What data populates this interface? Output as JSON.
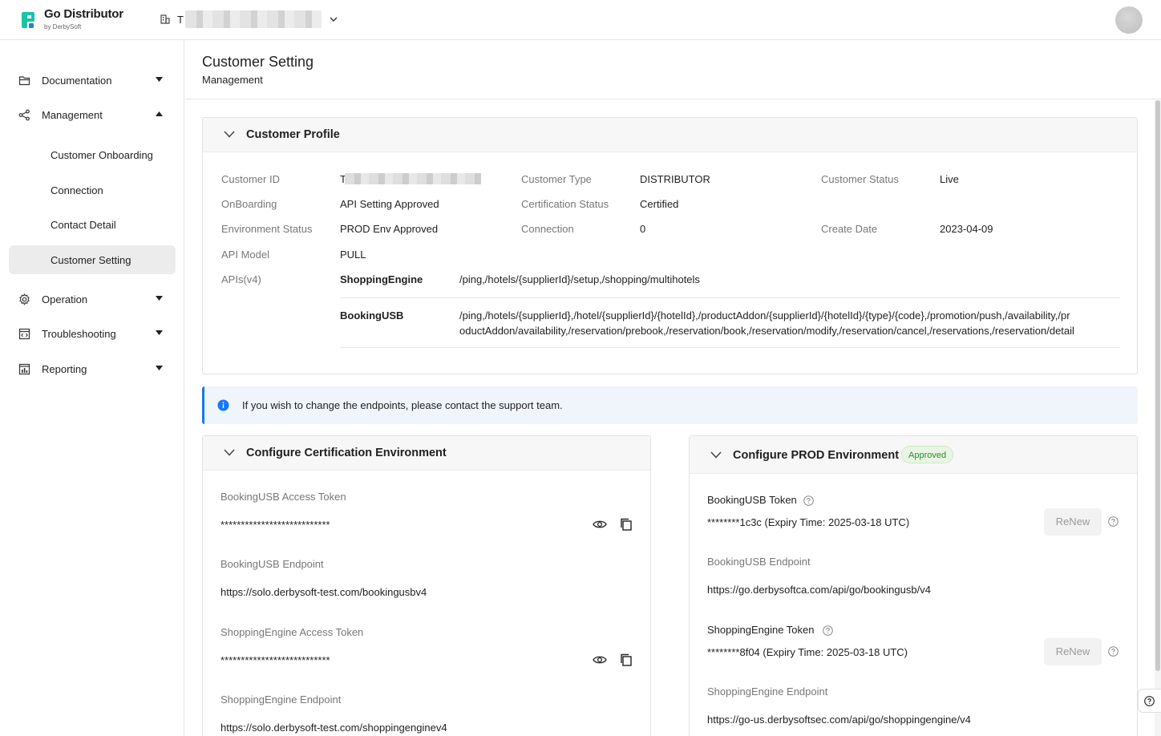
{
  "app": {
    "title": "Go Distributor",
    "subtitle": "by DerbySoft",
    "tenant_initial": "T",
    "brand_color": "#19c3a8"
  },
  "sidebar": {
    "documentation": "Documentation",
    "management": "Management",
    "management_items": [
      "Customer Onboarding",
      "Connection",
      "Contact Detail",
      "Customer Setting"
    ],
    "operation": "Operation",
    "troubleshooting": "Troubleshooting",
    "reporting": "Reporting"
  },
  "page": {
    "title": "Customer Setting",
    "breadcrumb": "Management"
  },
  "profile": {
    "title": "Customer Profile",
    "labels": {
      "customer_id": "Customer ID",
      "onboarding": "OnBoarding",
      "environment_status": "Environment Status",
      "api_model": "API Model",
      "apis": "APIs(v4)",
      "customer_type": "Customer Type",
      "certification_status": "Certification Status",
      "connection": "Connection",
      "customer_status": "Customer Status",
      "create_date": "Create Date"
    },
    "values": {
      "customer_id_initial": "T",
      "onboarding": "API Setting Approved",
      "environment_status": "PROD Env Approved",
      "api_model": "PULL",
      "customer_type": "DISTRIBUTOR",
      "certification_status": "Certified",
      "connection": "0",
      "customer_status": "Live",
      "create_date": "2023-04-09"
    },
    "apis": [
      {
        "name": "ShoppingEngine",
        "paths": [
          "/ping,/hotels/{supplierId}/setup,/shopping/multihotels"
        ]
      },
      {
        "name": "BookingUSB",
        "paths": [
          "/ping,/hotels/{supplierId},/hotel/{supplierId}/{hotelId},/productAddon/{supplierId}/{hotelId}/{type}/{code},/promotion/push,/availability,/pr",
          "oductAddon/availability,/reservation/prebook,/reservation/book,/reservation/modify,/reservation/cancel,/reservations,/reservation/detail"
        ]
      }
    ]
  },
  "info": {
    "message": "If you wish to change the endpoints, please contact the support team."
  },
  "cert_env": {
    "title": "Configure Certification Environment",
    "booking_token_label": "BookingUSB Access Token",
    "booking_token_value": "***************************",
    "booking_endpoint_label": "BookingUSB Endpoint",
    "booking_endpoint_value": "https://solo.derbysoft-test.com/bookingusbv4",
    "shopping_token_label": "ShoppingEngine Access Token",
    "shopping_token_value": "***************************",
    "shopping_endpoint_label": "ShoppingEngine Endpoint",
    "shopping_endpoint_value": "https://solo.derbysoft-test.com/shoppingenginev4"
  },
  "prod_env": {
    "title": "Configure PROD Environment",
    "badge": "Approved",
    "booking_token_label": "BookingUSB Token",
    "booking_token_value": "********1c3c (Expiry Time: 2025-03-18 UTC)",
    "booking_endpoint_label": "BookingUSB Endpoint",
    "booking_endpoint_value": "https://go.derbysoftca.com/api/go/bookingusb/v4",
    "shopping_token_label": "ShoppingEngine Token",
    "shopping_token_value": "********8f04 (Expiry Time: 2025-03-18 UTC)",
    "shopping_endpoint_label": "ShoppingEngine Endpoint",
    "shopping_endpoint_value": "https://go-us.derbysoftsec.com/api/go/shoppingengine/v4",
    "renew_label": "ReNew"
  }
}
